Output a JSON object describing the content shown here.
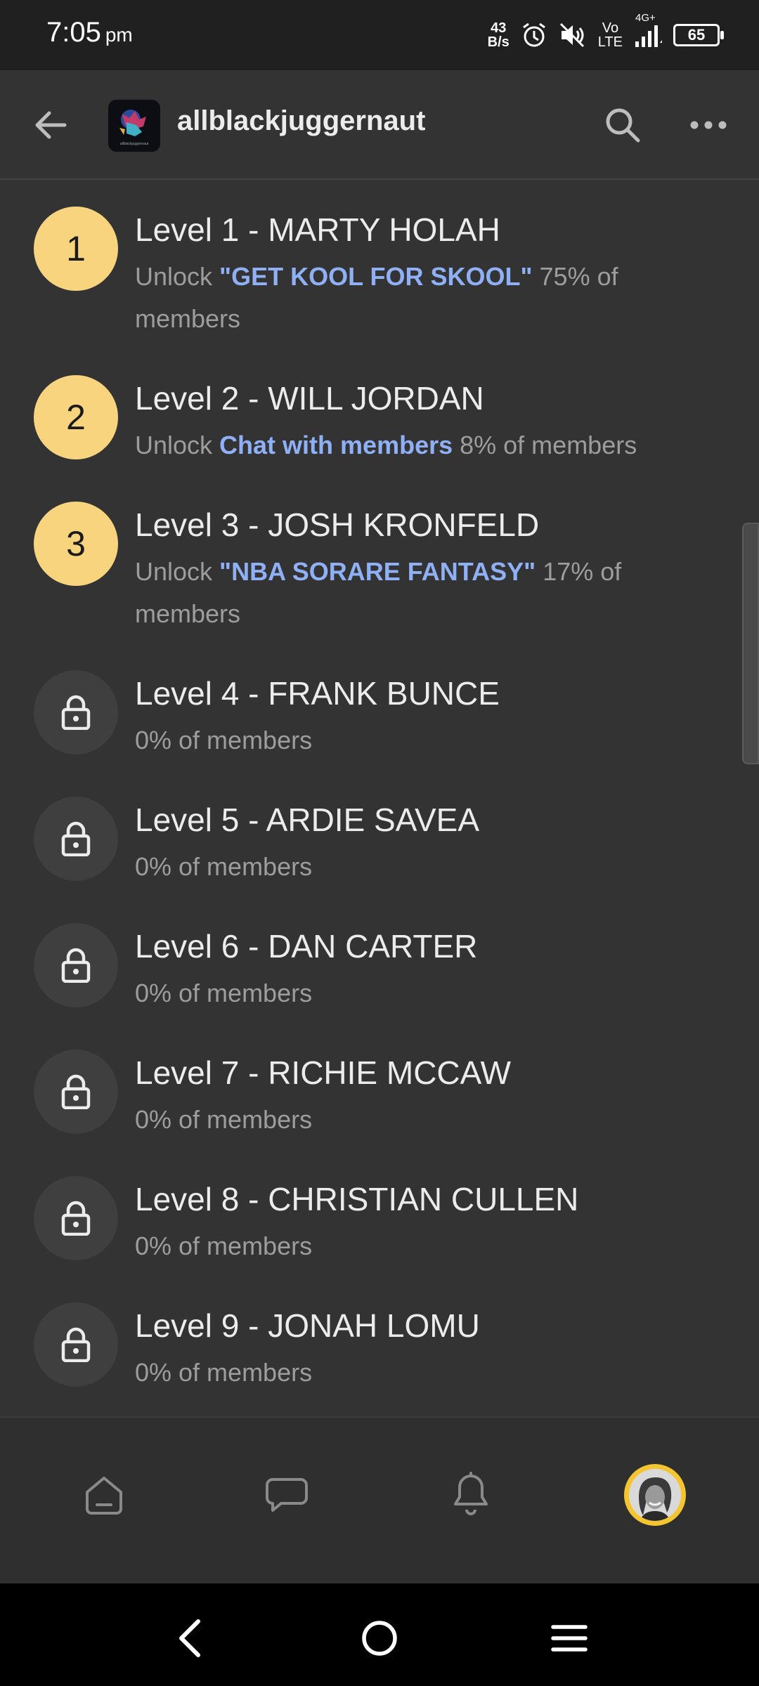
{
  "status_bar": {
    "time": "7:05",
    "ampm": "pm",
    "net_speed_value": "43",
    "net_speed_unit": "B/s",
    "volte_top": "Vo",
    "volte_bottom": "LTE",
    "network_type": "4G+",
    "battery_level": "65"
  },
  "header": {
    "group_name": "allblackjuggernaut",
    "avatar_caption": "allblackjuggernaut"
  },
  "levels": [
    {
      "badge": "1",
      "title": "Level 1 - MARTY HOLAH",
      "unlock_prefix": "Unlock ",
      "unlock_item": "\"GET KOOL FOR SKOOL\"",
      "members": " 75% of members",
      "locked": false
    },
    {
      "badge": "2",
      "title": "Level 2 - WILL JORDAN",
      "unlock_prefix": "Unlock ",
      "unlock_item": "Chat with members",
      "members": " 8% of members",
      "locked": false
    },
    {
      "badge": "3",
      "title": "Level 3 - JOSH KRONFELD",
      "unlock_prefix": "Unlock ",
      "unlock_item": "\"NBA SORARE FANTASY\"",
      "members": " 17% of members",
      "locked": false
    },
    {
      "title": "Level 4 - FRANK BUNCE",
      "members": "0% of members",
      "locked": true
    },
    {
      "title": "Level 5 - ARDIE SAVEA",
      "members": "0% of members",
      "locked": true
    },
    {
      "title": "Level 6 - DAN CARTER",
      "members": "0% of members",
      "locked": true
    },
    {
      "title": "Level 7 - RICHIE MCCAW",
      "members": "0% of members",
      "locked": true
    },
    {
      "title": "Level 8 - CHRISTIAN CULLEN",
      "members": "0% of members",
      "locked": true
    },
    {
      "title": "Level 9 - JONAH LOMU",
      "members": "0% of members",
      "locked": true
    }
  ],
  "colors": {
    "badge_unlocked": "#f8d47e",
    "link": "#8fb0f5",
    "background": "#333333"
  }
}
